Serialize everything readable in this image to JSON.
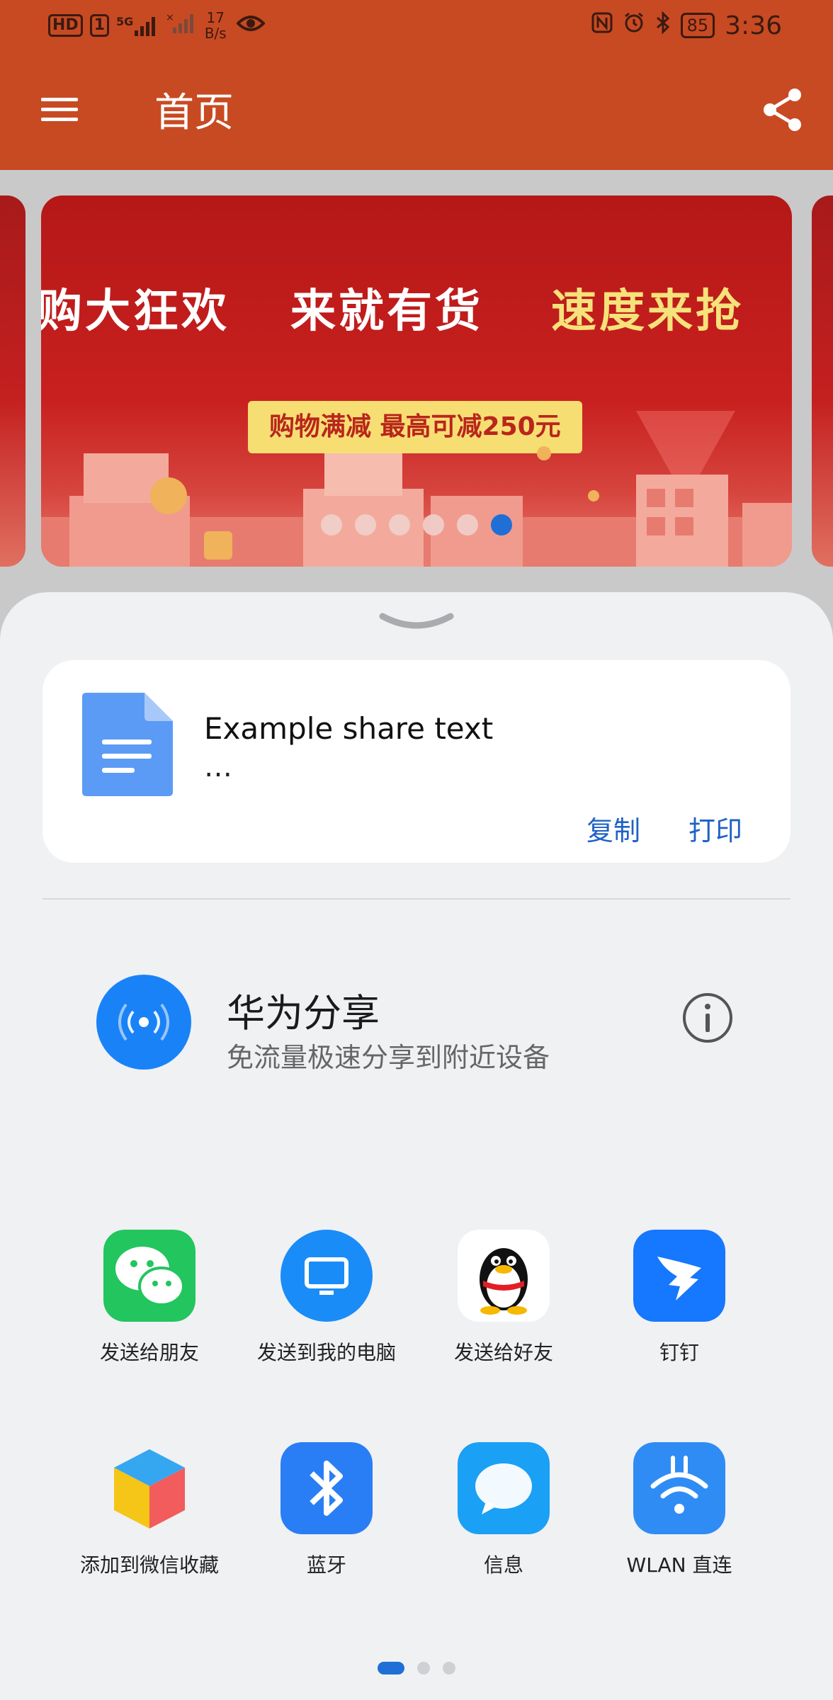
{
  "status_bar": {
    "left": {
      "hd": "HD",
      "sim": "1",
      "net_5g": "5G",
      "speed_value": "17",
      "speed_unit": "B/s"
    },
    "right": {
      "battery": "85",
      "time": "3:36"
    }
  },
  "appbar": {
    "title": "首页",
    "menu_icon": "hamburger-menu-icon",
    "share_icon": "share-icon"
  },
  "banner": {
    "headline_1": "购大狂欢",
    "headline_2": "来就有货",
    "headline_3": "速度来抢",
    "promo": "购物满减 最高可减250元",
    "dot_count": 6,
    "active_dot": 5
  },
  "share_sheet": {
    "preview": {
      "text": "Example share text",
      "ellipsis": "…",
      "file_icon": "document-icon"
    },
    "actions": {
      "copy": "复制",
      "print": "打印"
    },
    "huawei_share": {
      "title": "华为分享",
      "subtitle": "免流量极速分享到附近设备",
      "icon": "nearby-share-icon",
      "info_icon": "info-icon"
    },
    "apps": [
      {
        "label": "发送给朋友",
        "icon": "wechat-icon",
        "color": "#22c55e"
      },
      {
        "label": "发送到我的电脑",
        "icon": "computer-icon",
        "color": "#1a8cf7"
      },
      {
        "label": "发送给好友",
        "icon": "qq-penguin-icon",
        "color": "#ffffff"
      },
      {
        "label": "钉钉",
        "icon": "dingtalk-icon",
        "color": "#1677ff"
      },
      {
        "label": "添加到微信收藏",
        "icon": "cube-favorites-icon",
        "color": "#f5c518"
      },
      {
        "label": "蓝牙",
        "icon": "bluetooth-icon",
        "color": "#2a7ef5"
      },
      {
        "label": "信息",
        "icon": "message-bubble-icon",
        "color": "#1aa0f5"
      },
      {
        "label": "WLAN 直连",
        "icon": "wlan-direct-icon",
        "color": "#2f8cf5"
      }
    ],
    "pager": {
      "pages": 3,
      "active": 0
    }
  }
}
